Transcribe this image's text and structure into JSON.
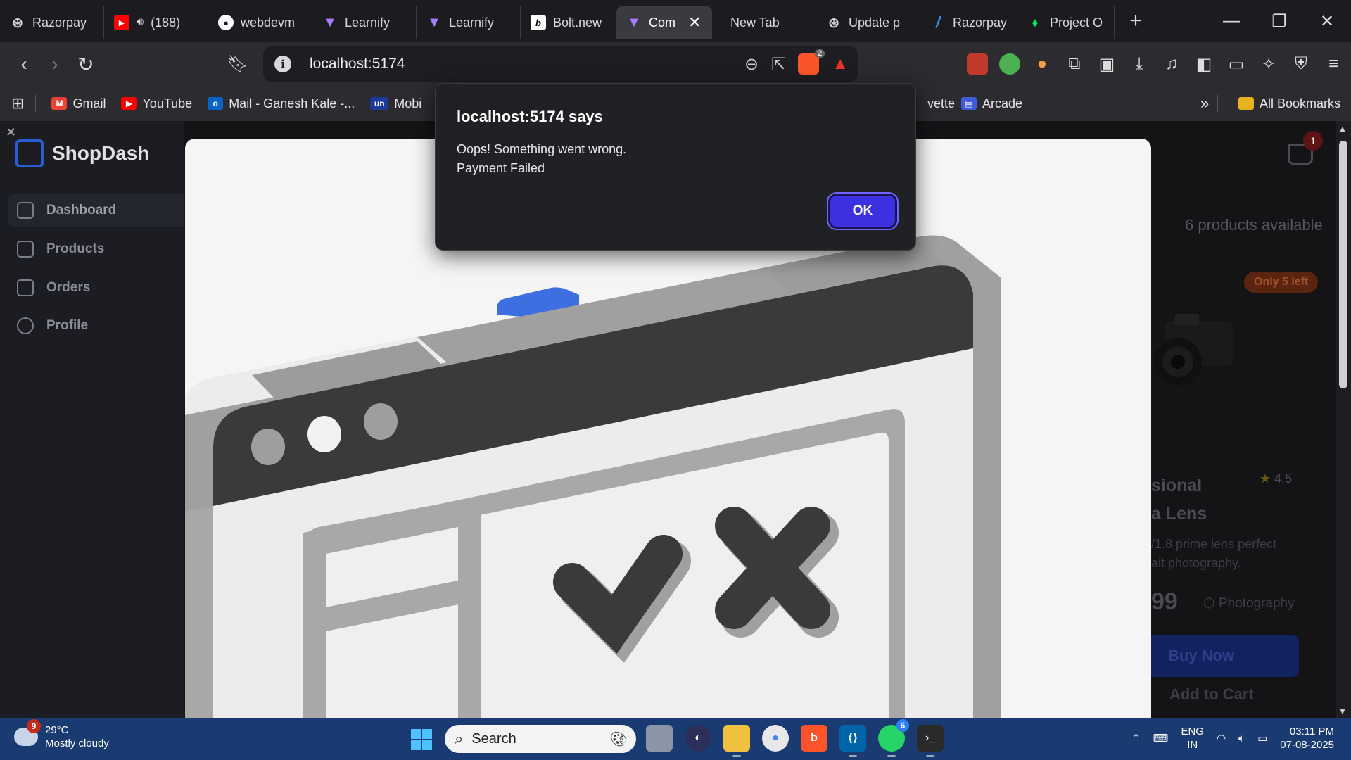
{
  "browser": {
    "tabs": [
      {
        "label": "Razorpay",
        "icon": "openai-icon",
        "active": false
      },
      {
        "label": "(188)",
        "icon": "youtube-icon",
        "active": false
      },
      {
        "label": "webdevm",
        "icon": "github-icon",
        "active": false
      },
      {
        "label": "Learnify",
        "icon": "vite-icon",
        "active": false
      },
      {
        "label": "Learnify",
        "icon": "vite-icon",
        "active": false
      },
      {
        "label": "Bolt.new",
        "icon": "bolt-icon",
        "active": false
      },
      {
        "label": "Com",
        "icon": "vite-icon",
        "active": true
      },
      {
        "label": "New Tab",
        "icon": "",
        "active": false
      },
      {
        "label": "Update p",
        "icon": "openai-icon",
        "active": false
      },
      {
        "label": "Razorpay",
        "icon": "razorpay-icon",
        "active": false
      },
      {
        "label": "Project O",
        "icon": "mongodb-icon",
        "active": false
      }
    ],
    "address": "localhost:5174",
    "shields_count": "2",
    "bookmarks": [
      {
        "label": "Gmail",
        "icon": "gmail-icon",
        "color": "#ea4335"
      },
      {
        "label": "YouTube",
        "icon": "youtube-icon",
        "color": "#ff0000"
      },
      {
        "label": "Mail - Ganesh Kale -...",
        "icon": "outlook-icon",
        "color": "#0a64c8"
      },
      {
        "label": "Mobi",
        "icon": "unstop-icon",
        "color": "#1c3a9a"
      },
      {
        "label": "vette",
        "icon": "",
        "color": ""
      },
      {
        "label": "Arcade",
        "icon": "arcade-icon",
        "color": "#3f5bd6"
      }
    ],
    "all_bookmarks": "All Bookmarks"
  },
  "app": {
    "brand": "ShopDash",
    "nav": [
      {
        "label": "Dashboard",
        "active": true
      },
      {
        "label": "Products",
        "active": false
      },
      {
        "label": "Orders",
        "active": false
      },
      {
        "label": "Profile",
        "active": false
      }
    ],
    "cart_count": "1",
    "products_available": "6 products available",
    "card": {
      "stock_badge": "Only 5 left",
      "title_line1": "sional",
      "title_line2": "a Lens",
      "rating": "4.5",
      "desc_line1": "/1.8 prime lens perfect",
      "desc_line2": "ait photography.",
      "price": "99",
      "category": "Photography",
      "buy_now": "Buy Now",
      "add_to_cart": "Add to Cart"
    }
  },
  "alert": {
    "title": "localhost:5174 says",
    "message": "Oops! Something went wrong.\nPayment Failed",
    "ok_label": "OK"
  },
  "taskbar": {
    "weather_badge": "9",
    "temperature": "29°C",
    "condition": "Mostly cloudy",
    "search_placeholder": "Search",
    "whatsapp_badge": "6",
    "lang_line1": "ENG",
    "lang_line2": "IN",
    "time": "03:11 PM",
    "date": "07-08-2025"
  }
}
